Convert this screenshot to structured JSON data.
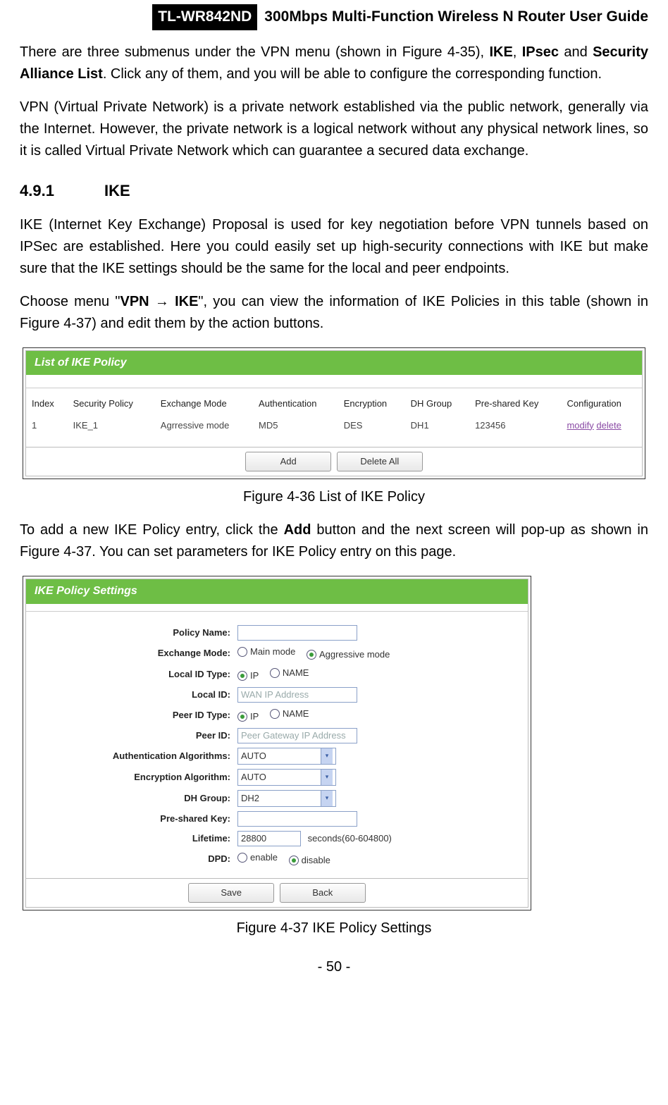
{
  "header": {
    "model": "TL-WR842ND",
    "title": "300Mbps Multi-Function Wireless N Router User Guide"
  },
  "paragraphs": {
    "p1_a": "There are three submenus under the VPN menu (shown in Figure 4-35), ",
    "p1_b_ike": "IKE",
    "p1_sep1": ", ",
    "p1_b_ipsec": "IPsec",
    "p1_and": " and ",
    "p1_b_sal": "Security Alliance List",
    "p1_c": ". Click any of them, and you will be able to configure the corresponding function.",
    "p2": "VPN (Virtual Private Network) is a private network established via the public network, generally via the Internet. However, the private network is a logical network without any physical network lines, so it is called Virtual Private Network which can guarantee a secured data exchange.",
    "p3": "IKE (Internet Key Exchange) Proposal is used for key negotiation before VPN tunnels based on IPSec are established. Here you could easily set up high-security connections with IKE but make sure that the IKE settings should be the same for the local and peer endpoints.",
    "p4_a": "Choose menu \"",
    "p4_vpn": "VPN",
    "p4_arrow": " → ",
    "p4_ike": "IKE",
    "p4_b": "\", you can view the information of IKE Policies in this table (shown in Figure 4-37) and edit them by the action buttons.",
    "p5_a": "To add a new IKE Policy entry, click the ",
    "p5_add": "Add",
    "p5_b": " button and the next screen will pop-up as shown in Figure 4-37. You can set parameters for IKE Policy entry on this page."
  },
  "section": {
    "num": "4.9.1",
    "title": "IKE"
  },
  "fig1": {
    "title": "List of IKE Policy",
    "headers": {
      "index": "Index",
      "policy": "Security Policy",
      "exmode": "Exchange Mode",
      "auth": "Authentication",
      "enc": "Encryption",
      "dh": "DH Group",
      "psk": "Pre-shared Key",
      "cfg": "Configuration"
    },
    "row": {
      "index": "1",
      "policy": "IKE_1",
      "exmode": "Agrressive mode",
      "auth": "MD5",
      "enc": "DES",
      "dh": "DH1",
      "psk": "123456",
      "modify": "modify",
      "delete": "delete"
    },
    "buttons": {
      "add": "Add",
      "deleteAll": "Delete All"
    },
    "caption": "Figure 4-36 List of IKE Policy"
  },
  "fig2": {
    "title": "IKE Policy Settings",
    "labels": {
      "policyName": "Policy Name:",
      "exMode": "Exchange Mode:",
      "localIdType": "Local ID Type:",
      "localId": "Local ID:",
      "peerIdType": "Peer ID Type:",
      "peerId": "Peer ID:",
      "authAlg": "Authentication Algorithms:",
      "encAlg": "Encryption Algorithm:",
      "dhGroup": "DH Group:",
      "psk": "Pre-shared Key:",
      "lifetime": "Lifetime:",
      "dpd": "DPD:"
    },
    "values": {
      "exMain": "Main mode",
      "exAgg": "Aggressive mode",
      "optIP": "IP",
      "optName": "NAME",
      "localIdPh": "WAN IP Address",
      "peerIdPh": "Peer Gateway IP Address",
      "auto": "AUTO",
      "dh2": "DH2",
      "lifetime": "28800",
      "lifetimeSuffix": "seconds(60-604800)",
      "enable": "enable",
      "disable": "disable"
    },
    "buttons": {
      "save": "Save",
      "back": "Back"
    },
    "caption": "Figure 4-37 IKE Policy Settings"
  },
  "pageNumber": "- 50 -"
}
